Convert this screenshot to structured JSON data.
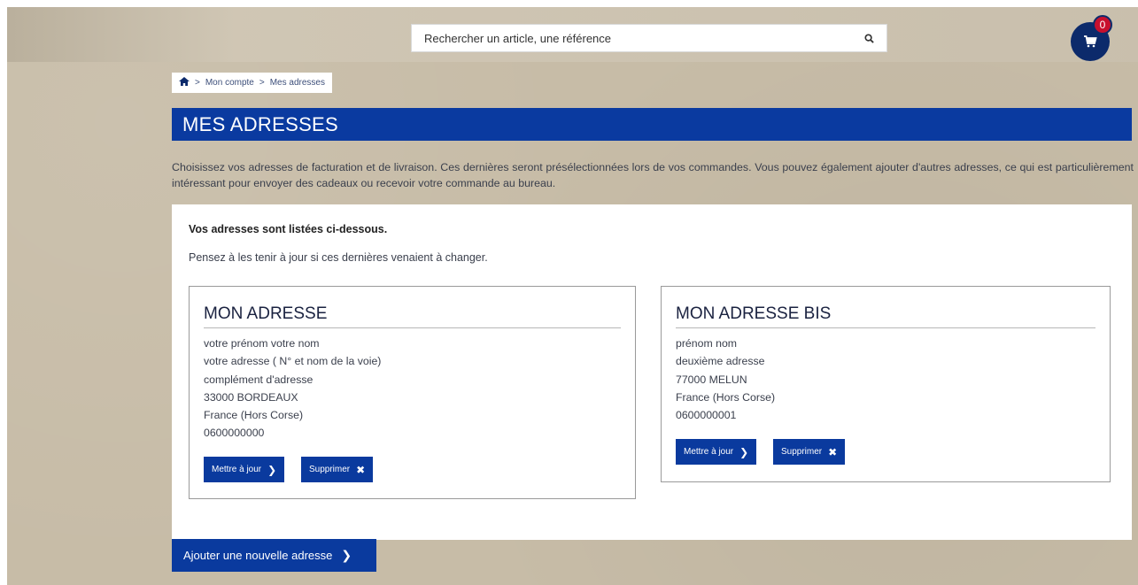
{
  "header": {
    "search_placeholder": "Rechercher un article, une référence",
    "cart_count": "0"
  },
  "breadcrumb": {
    "items": [
      "Mon compte",
      "Mes adresses"
    ],
    "separator": ">"
  },
  "page": {
    "title": "MES ADRESSES",
    "intro": "Choisissez vos adresses de facturation et de livraison. Ces dernières seront présélectionnées lors de vos commandes. Vous pouvez également ajouter d'autres adresses, ce qui est particulièrement intéressant pour envoyer des cadeaux ou recevoir votre commande au bureau."
  },
  "panel": {
    "heading": "Vos adresses sont listées ci-dessous.",
    "subtext": "Pensez à les tenir à jour si ces dernières venaient à changer."
  },
  "addresses": [
    {
      "title": "MON ADRESSE",
      "lines": [
        "votre prénom votre nom",
        "votre adresse ( N° et nom de la voie)",
        "complément d'adresse",
        "33000 BORDEAUX",
        "France (Hors Corse)",
        "0600000000"
      ],
      "update_label": "Mettre à jour",
      "delete_label": "Supprimer"
    },
    {
      "title": "MON ADRESSE BIS",
      "lines": [
        "prénom nom",
        "deuxième adresse",
        "77000 MELUN",
        "France (Hors Corse)",
        "0600000001"
      ],
      "update_label": "Mettre à jour",
      "delete_label": "Supprimer"
    }
  ],
  "actions": {
    "add_address_label": "Ajouter une nouvelle adresse"
  },
  "icons": {
    "home": "home-icon",
    "search": "search-icon",
    "cart": "cart-icon",
    "chevron": "chevron-right-icon",
    "close": "close-icon"
  },
  "colors": {
    "brand_blue": "#0a3aa0",
    "dark_blue": "#0c2a6b",
    "badge_red": "#c8102e"
  }
}
